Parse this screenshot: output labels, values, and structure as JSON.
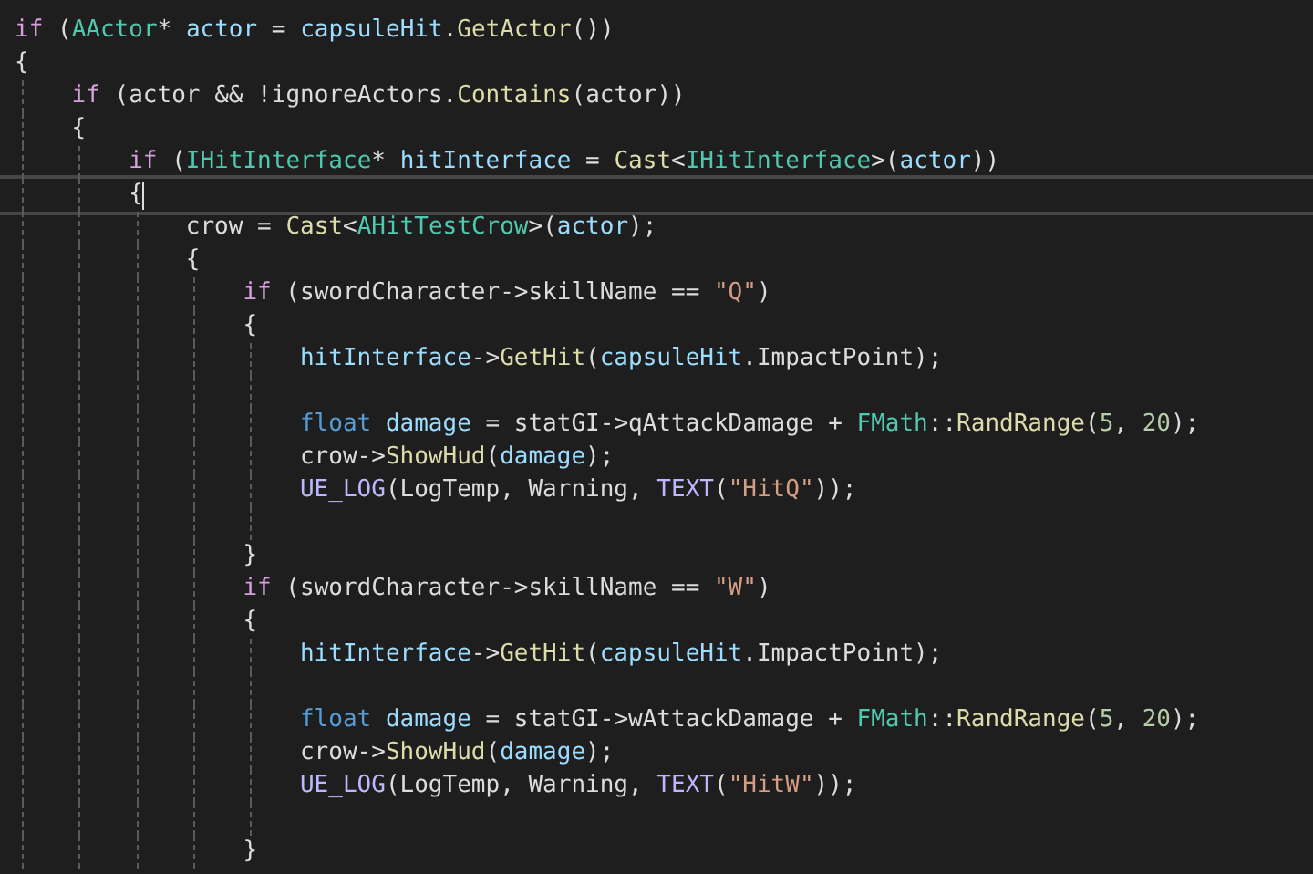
{
  "editor": {
    "lines": [
      {
        "current": false,
        "tokens": [
          {
            "kind": "control",
            "text": "if"
          },
          {
            "kind": "plain",
            "text": " ("
          },
          {
            "kind": "type",
            "text": "AActor"
          },
          {
            "kind": "plain",
            "text": "* "
          },
          {
            "kind": "variable",
            "text": "actor"
          },
          {
            "kind": "plain",
            "text": " = "
          },
          {
            "kind": "variable",
            "text": "capsuleHit"
          },
          {
            "kind": "plain",
            "text": "."
          },
          {
            "kind": "function",
            "text": "GetActor"
          },
          {
            "kind": "plain",
            "text": "())"
          }
        ]
      },
      {
        "current": false,
        "tokens": [
          {
            "kind": "plain",
            "text": "{"
          }
        ],
        "children": [
          {
            "current": false,
            "tokens": [
              {
                "kind": "control",
                "text": "if"
              },
              {
                "kind": "plain",
                "text": " (actor && !ignoreActors."
              },
              {
                "kind": "function",
                "text": "Contains"
              },
              {
                "kind": "plain",
                "text": "(actor))"
              }
            ]
          },
          {
            "current": false,
            "tokens": [
              {
                "kind": "plain",
                "text": "{"
              }
            ],
            "children": [
              {
                "current": false,
                "tokens": [
                  {
                    "kind": "control",
                    "text": "if"
                  },
                  {
                    "kind": "plain",
                    "text": " ("
                  },
                  {
                    "kind": "type",
                    "text": "IHitInterface"
                  },
                  {
                    "kind": "plain",
                    "text": "* "
                  },
                  {
                    "kind": "variable",
                    "text": "hitInterface"
                  },
                  {
                    "kind": "plain",
                    "text": " = "
                  },
                  {
                    "kind": "function",
                    "text": "Cast"
                  },
                  {
                    "kind": "plain",
                    "text": "<"
                  },
                  {
                    "kind": "type",
                    "text": "IHitInterface"
                  },
                  {
                    "kind": "plain",
                    "text": ">("
                  },
                  {
                    "kind": "variable",
                    "text": "actor"
                  },
                  {
                    "kind": "plain",
                    "text": "))"
                  }
                ]
              },
              {
                "current": true,
                "tokens": [
                  {
                    "kind": "plain",
                    "text": "{"
                  }
                ],
                "children": [
                  {
                    "current": false,
                    "tokens": [
                      {
                        "kind": "plain",
                        "text": "crow = "
                      },
                      {
                        "kind": "function",
                        "text": "Cast"
                      },
                      {
                        "kind": "plain",
                        "text": "<"
                      },
                      {
                        "kind": "type",
                        "text": "AHitTestCrow"
                      },
                      {
                        "kind": "plain",
                        "text": ">("
                      },
                      {
                        "kind": "variable",
                        "text": "actor"
                      },
                      {
                        "kind": "plain",
                        "text": ");"
                      }
                    ]
                  },
                  {
                    "current": false,
                    "tokens": [
                      {
                        "kind": "plain",
                        "text": "{"
                      }
                    ],
                    "children": [
                      {
                        "current": false,
                        "tokens": [
                          {
                            "kind": "control",
                            "text": "if"
                          },
                          {
                            "kind": "plain",
                            "text": " (swordCharacter->skillName == "
                          },
                          {
                            "kind": "string",
                            "text": "\"Q\""
                          },
                          {
                            "kind": "plain",
                            "text": ")"
                          }
                        ]
                      },
                      {
                        "current": false,
                        "tokens": [
                          {
                            "kind": "plain",
                            "text": "{"
                          }
                        ],
                        "children": [
                          {
                            "current": false,
                            "tokens": [
                              {
                                "kind": "variable",
                                "text": "hitInterface"
                              },
                              {
                                "kind": "plain",
                                "text": "->"
                              },
                              {
                                "kind": "function",
                                "text": "GetHit"
                              },
                              {
                                "kind": "plain",
                                "text": "("
                              },
                              {
                                "kind": "variable",
                                "text": "capsuleHit"
                              },
                              {
                                "kind": "plain",
                                "text": ".ImpactPoint);"
                              }
                            ]
                          },
                          {
                            "current": false
                          },
                          {
                            "current": false,
                            "tokens": [
                              {
                                "kind": "keyword",
                                "text": "float "
                              },
                              {
                                "kind": "variable",
                                "text": "damage"
                              },
                              {
                                "kind": "plain",
                                "text": " = statGI->qAttackDamage + "
                              },
                              {
                                "kind": "type",
                                "text": "FMath"
                              },
                              {
                                "kind": "plain",
                                "text": "::"
                              },
                              {
                                "kind": "function",
                                "text": "RandRange"
                              },
                              {
                                "kind": "plain",
                                "text": "("
                              },
                              {
                                "kind": "number",
                                "text": "5"
                              },
                              {
                                "kind": "plain",
                                "text": ", "
                              },
                              {
                                "kind": "number",
                                "text": "20"
                              },
                              {
                                "kind": "plain",
                                "text": ");"
                              }
                            ]
                          },
                          {
                            "current": false,
                            "tokens": [
                              {
                                "kind": "plain",
                                "text": "crow->"
                              },
                              {
                                "kind": "function",
                                "text": "ShowHud"
                              },
                              {
                                "kind": "plain",
                                "text": "("
                              },
                              {
                                "kind": "variable",
                                "text": "damage"
                              },
                              {
                                "kind": "plain",
                                "text": ");"
                              }
                            ]
                          },
                          {
                            "current": false,
                            "tokens": [
                              {
                                "kind": "macro",
                                "text": "UE_LOG"
                              },
                              {
                                "kind": "plain",
                                "text": "(LogTemp, Warning, "
                              },
                              {
                                "kind": "macro",
                                "text": "TEXT"
                              },
                              {
                                "kind": "plain",
                                "text": "("
                              },
                              {
                                "kind": "string",
                                "text": "\"HitQ\""
                              },
                              {
                                "kind": "plain",
                                "text": "));"
                              }
                            ]
                          },
                          {
                            "current": false
                          }
                        ]
                      },
                      {
                        "current": false,
                        "tokens": [
                          {
                            "kind": "plain",
                            "text": "}"
                          }
                        ]
                      },
                      {
                        "current": false,
                        "tokens": [
                          {
                            "kind": "control",
                            "text": "if"
                          },
                          {
                            "kind": "plain",
                            "text": " (swordCharacter->skillName == "
                          },
                          {
                            "kind": "string",
                            "text": "\"W\""
                          },
                          {
                            "kind": "plain",
                            "text": ")"
                          }
                        ]
                      },
                      {
                        "current": false,
                        "tokens": [
                          {
                            "kind": "plain",
                            "text": "{"
                          }
                        ],
                        "children": [
                          {
                            "current": false,
                            "tokens": [
                              {
                                "kind": "variable",
                                "text": "hitInterface"
                              },
                              {
                                "kind": "plain",
                                "text": "->"
                              },
                              {
                                "kind": "function",
                                "text": "GetHit"
                              },
                              {
                                "kind": "plain",
                                "text": "("
                              },
                              {
                                "kind": "variable",
                                "text": "capsuleHit"
                              },
                              {
                                "kind": "plain",
                                "text": ".ImpactPoint);"
                              }
                            ]
                          },
                          {
                            "current": false
                          },
                          {
                            "current": false,
                            "tokens": [
                              {
                                "kind": "keyword",
                                "text": "float "
                              },
                              {
                                "kind": "variable",
                                "text": "damage"
                              },
                              {
                                "kind": "plain",
                                "text": " = statGI->wAttackDamage + "
                              },
                              {
                                "kind": "type",
                                "text": "FMath"
                              },
                              {
                                "kind": "plain",
                                "text": "::"
                              },
                              {
                                "kind": "function",
                                "text": "RandRange"
                              },
                              {
                                "kind": "plain",
                                "text": "("
                              },
                              {
                                "kind": "number",
                                "text": "5"
                              },
                              {
                                "kind": "plain",
                                "text": ", "
                              },
                              {
                                "kind": "number",
                                "text": "20"
                              },
                              {
                                "kind": "plain",
                                "text": ");"
                              }
                            ]
                          },
                          {
                            "current": false,
                            "tokens": [
                              {
                                "kind": "plain",
                                "text": "crow->"
                              },
                              {
                                "kind": "function",
                                "text": "ShowHud"
                              },
                              {
                                "kind": "plain",
                                "text": "("
                              },
                              {
                                "kind": "variable",
                                "text": "damage"
                              },
                              {
                                "kind": "plain",
                                "text": ");"
                              }
                            ]
                          },
                          {
                            "current": false,
                            "tokens": [
                              {
                                "kind": "macro",
                                "text": "UE_LOG"
                              },
                              {
                                "kind": "plain",
                                "text": "(LogTemp, Warning, "
                              },
                              {
                                "kind": "macro",
                                "text": "TEXT"
                              },
                              {
                                "kind": "plain",
                                "text": "("
                              },
                              {
                                "kind": "string",
                                "text": "\"HitW\""
                              },
                              {
                                "kind": "plain",
                                "text": "));"
                              }
                            ]
                          },
                          {
                            "current": false
                          }
                        ]
                      },
                      {
                        "current": false,
                        "tokens": [
                          {
                            "kind": "plain",
                            "text": "}"
                          }
                        ]
                      }
                    ]
                  }
                ]
              }
            ]
          }
        ]
      }
    ]
  }
}
